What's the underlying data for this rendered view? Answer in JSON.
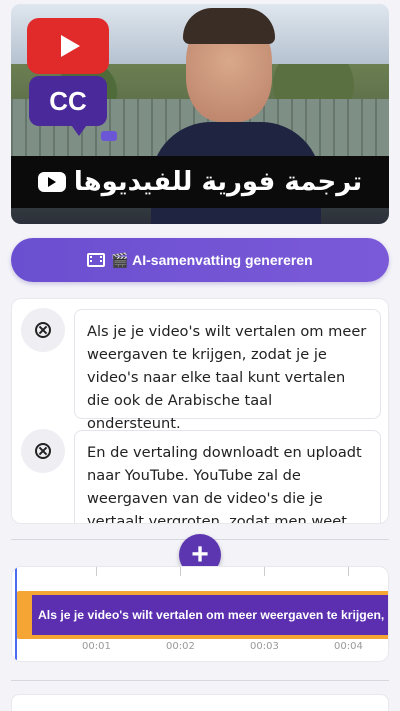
{
  "video": {
    "cc_label": "CC",
    "banner_text": "ترجمة فورية للفيديوها"
  },
  "ai_button": {
    "label": "🎬 AI-samenvatting genereren"
  },
  "segments": [
    {
      "text": "Als je je video's wilt vertalen om meer weergaven te krijgen, zodat je je video's naar elke taal kunt vertalen die ook de Arabische taal ondersteunt."
    },
    {
      "text": "En de vertaling downloadt en uploadt naar YouTube. YouTube zal de weergaven van de video's die je vertaalt vergroten, zodat men weet wat de"
    }
  ],
  "add_button": {
    "label": "+"
  },
  "timeline": {
    "clip_text": "Als je je video's wilt vertalen om meer weergaven te krijgen, zodat je",
    "time_labels": [
      "00:01",
      "00:02",
      "00:03",
      "00:04"
    ]
  },
  "colors": {
    "accent": "#6a4fd0",
    "clip_border": "#f4a533",
    "clip_fill": "#5b2fb0",
    "playhead": "#4c6cf0",
    "youtube_red": "#e12a2a"
  }
}
